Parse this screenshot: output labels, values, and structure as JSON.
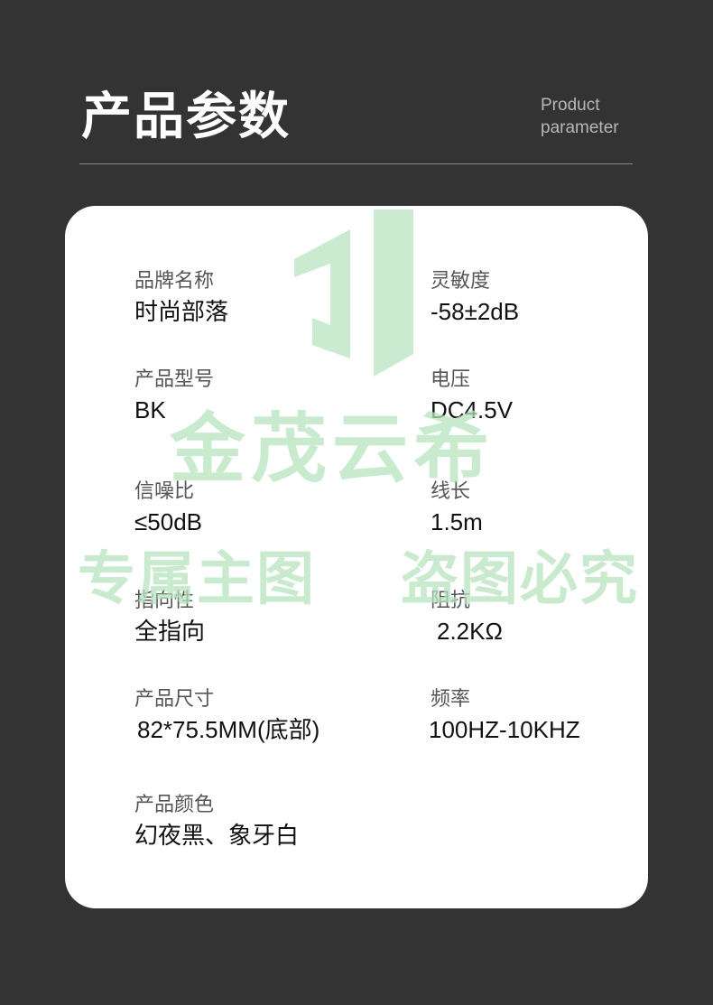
{
  "header": {
    "title": "产品参数",
    "subtitle_line1": "Product",
    "subtitle_line2": "parameter"
  },
  "params": [
    {
      "label": "品牌名称",
      "value": "时尚部落"
    },
    {
      "label": "灵敏度",
      "value": "-58±2dB"
    },
    {
      "label": "产品型号",
      "value": "BK"
    },
    {
      "label": "电压",
      "value": "DC4.5V"
    },
    {
      "label": "信噪比",
      "value": "≤50dB"
    },
    {
      "label": "线长",
      "value": "1.5m"
    },
    {
      "label": "指向性",
      "value": "全指向"
    },
    {
      "label": "阻抗",
      "value": "2.2KΩ"
    },
    {
      "label": "产品尺寸",
      "value": "82*75.5MM(底部)"
    },
    {
      "label": "频率",
      "value": "100HZ-10KHZ"
    },
    {
      "label": "产品颜色",
      "value": "幻夜黑、象牙白"
    }
  ],
  "watermark": {
    "brand": "金茂云希",
    "left_text": "专属主图",
    "right_text": "盗图必究",
    "color": "#b6e3bd"
  },
  "colors": {
    "background": "#333333",
    "card": "#ffffff",
    "title": "#ffffff",
    "subtitle": "#b8b8b8",
    "label": "#555555",
    "value": "#111111"
  }
}
